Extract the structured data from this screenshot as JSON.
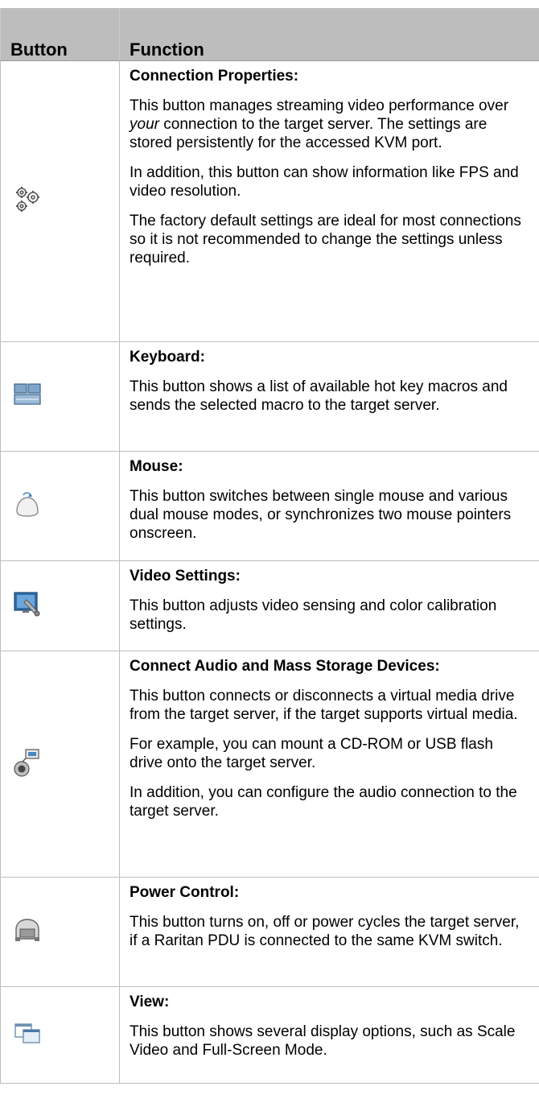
{
  "table": {
    "headers": {
      "button": "Button",
      "function": "Function"
    },
    "rows": [
      {
        "icon": "gears-icon",
        "title": "Connection Properties",
        "paragraphs": [
          "This button manages streaming video performance over your connection to the target server. The settings are stored persistently for the accessed KVM port.",
          "In addition, this button can show information like FPS and video resolution.",
          "The factory default settings are ideal for most connections so it is not recommended to change the settings unless required."
        ]
      },
      {
        "icon": "keyboard-icon",
        "title": "Keyboard",
        "paragraphs": [
          "This button shows a list of available hot key macros and sends the selected macro to the target server."
        ]
      },
      {
        "icon": "mouse-icon",
        "title": "Mouse",
        "paragraphs": [
          "This button switches between single mouse and various dual mouse modes, or synchronizes two mouse pointers onscreen."
        ]
      },
      {
        "icon": "video-settings-icon",
        "title": "Video Settings",
        "paragraphs": [
          "This button adjusts video sensing and color calibration settings."
        ]
      },
      {
        "icon": "audio-media-icon",
        "title": "Connect Audio and Mass Storage Devices",
        "paragraphs": [
          "This button connects or disconnects a virtual media drive from the target server, if the target supports virtual media.",
          "For example, you can mount a CD-ROM or USB flash drive onto the target server.",
          "In addition, you can configure the audio connection to the target server."
        ]
      },
      {
        "icon": "power-control-icon",
        "title": "Power Control",
        "paragraphs": [
          "This button turns on, off or power cycles the target server, if a Raritan PDU is connected to the same KVM switch."
        ]
      },
      {
        "icon": "view-icon",
        "title": "View",
        "paragraphs": [
          "This button shows several display options, such as Scale Video and Full-Screen Mode."
        ]
      }
    ]
  }
}
